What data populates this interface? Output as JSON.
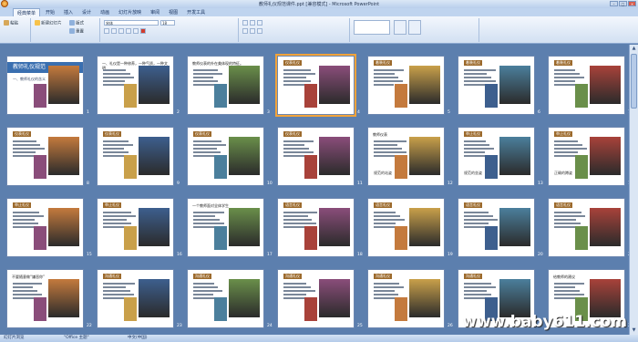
{
  "window": {
    "title": "教师礼仪规范课件.ppt [兼容模式] - Microsoft PowerPoint"
  },
  "tabs": [
    "经典菜单",
    "开始",
    "插入",
    "设计",
    "动画",
    "幻灯片放映",
    "审阅",
    "视图",
    "开发工具"
  ],
  "ribbon": {
    "font_name": "宋体",
    "font_size": "18",
    "layout_label": "版式",
    "reset_label": "重置",
    "new_slide_label": "新建幻灯片",
    "paste_label": "粘贴"
  },
  "slides": [
    {
      "n": "1",
      "title": "教师礼仪规范",
      "subtitle": "一、教师礼仪的含义"
    },
    {
      "n": "2",
      "text": "一、礼仪是一种修养，一种气质，一种文明"
    },
    {
      "n": "3",
      "text": "教师仪表的外在美体现的特征。"
    },
    {
      "n": "4",
      "badge": "仪表礼仪"
    },
    {
      "n": "5",
      "badge": "着装礼仪"
    },
    {
      "n": "6",
      "badge": "着装礼仪"
    },
    {
      "n": "7",
      "badge": "着装礼仪"
    },
    {
      "n": "8",
      "badge": "仪表礼仪"
    },
    {
      "n": "9",
      "badge": "仪表礼仪"
    },
    {
      "n": "10",
      "badge": "仪表礼仪"
    },
    {
      "n": "11",
      "badge": "仪表礼仪"
    },
    {
      "n": "12",
      "text": "教师仪表",
      "caption": "规范的站姿"
    },
    {
      "n": "13",
      "badge": "举止礼仪",
      "caption": "规范的坐姿"
    },
    {
      "n": "14",
      "badge": "举止礼仪",
      "caption": "正确的蹲姿"
    },
    {
      "n": "15",
      "badge": "举止礼仪"
    },
    {
      "n": "16",
      "badge": "举止礼仪"
    },
    {
      "n": "17",
      "text": "一个教师面对全体学生"
    },
    {
      "n": "18",
      "badge": "语言礼仪"
    },
    {
      "n": "19",
      "badge": "语言礼仪"
    },
    {
      "n": "20",
      "badge": "语言礼仪"
    },
    {
      "n": "21",
      "badge": "语言礼仪"
    },
    {
      "n": "22",
      "text": "不要随意做“嫌恶你”"
    },
    {
      "n": "23",
      "badge": "沟通礼仪"
    },
    {
      "n": "24",
      "badge": "沟通礼仪"
    },
    {
      "n": "25",
      "badge": "沟通礼仪"
    },
    {
      "n": "26",
      "badge": "沟通礼仪"
    },
    {
      "n": "27",
      "badge": "沟通礼仪"
    },
    {
      "n": "28",
      "text": "给教师的建议"
    }
  ],
  "status": {
    "slide_sorter": "幻灯片浏览",
    "theme": "\"Office 主题\"",
    "language": "中文(中国)"
  },
  "watermark": "www.baby611.com"
}
